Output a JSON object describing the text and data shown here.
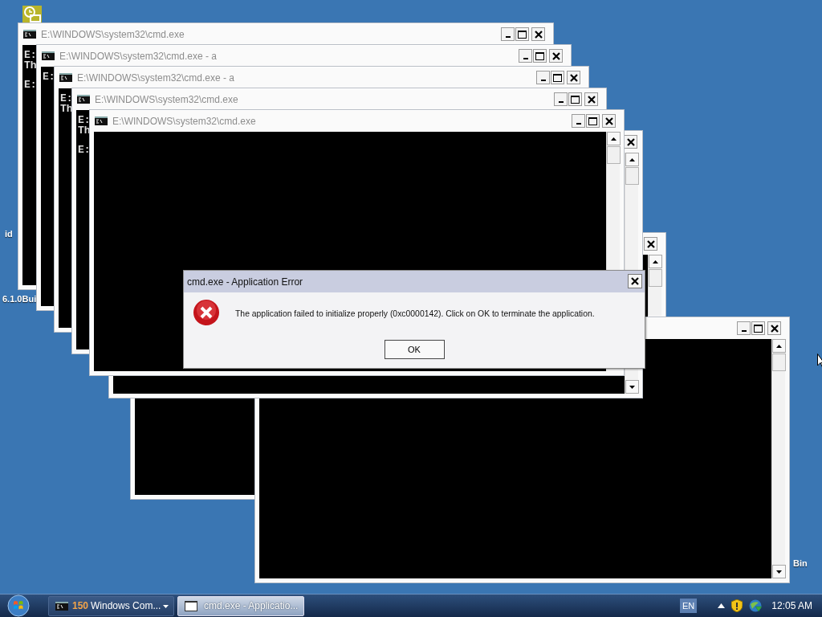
{
  "desktop": {
    "labels": [
      {
        "text": "id"
      },
      {
        "text": "6.1.0Bui"
      },
      {
        "text": "Bin"
      }
    ]
  },
  "windows": [
    {
      "kind": "console",
      "title": "E:\\WINDOWS\\system32\\cmd.exe",
      "blocks": [
        [
          "E:",
          "Th"
        ],
        [
          "E:"
        ]
      ]
    },
    {
      "kind": "console",
      "title": "E:\\WINDOWS\\system32\\cmd.exe - a",
      "blocks": [
        [
          "E:"
        ]
      ]
    },
    {
      "kind": "console",
      "title": "E:\\WINDOWS\\system32\\cmd.exe - a",
      "blocks": [
        [
          "E:",
          "Th"
        ]
      ]
    },
    {
      "kind": "console",
      "title": "E:\\WINDOWS\\system32\\cmd.exe",
      "blocks": [
        [
          "E:",
          "Th"
        ],
        [
          "E:"
        ]
      ]
    },
    {
      "kind": "console",
      "title": "E:\\WINDOWS\\system32\\cmd.exe"
    },
    {
      "kind": "console"
    },
    {
      "kind": "console"
    },
    {
      "kind": "console"
    }
  ],
  "dialog": {
    "title": "cmd.exe - Application Error",
    "message": "The application failed to initialize properly (0xc0000142). Click on OK to terminate the application.",
    "button": "OK"
  },
  "taskbar": {
    "buttons": [
      {
        "kind": "group",
        "count": "150",
        "label": "Windows Com...",
        "selected": false
      },
      {
        "kind": "window",
        "label": "cmd.exe - Applicatio...",
        "selected": true
      }
    ],
    "language": "EN",
    "clock": "12:05 AM"
  }
}
